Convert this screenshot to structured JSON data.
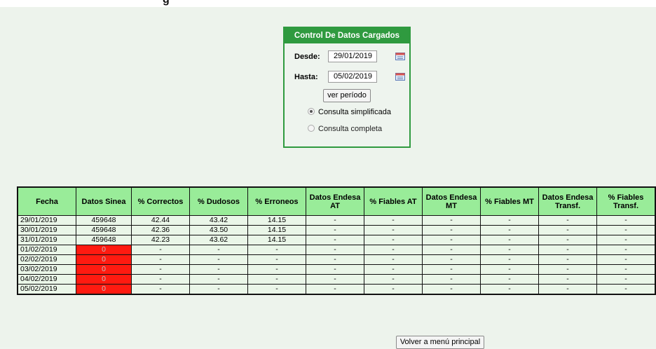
{
  "header": {
    "clipped_title": "g"
  },
  "panel": {
    "title": "Control De Datos Cargados",
    "desde_label": "Desde:",
    "desde_value": "29/01/2019",
    "hasta_label": "Hasta:",
    "hasta_value": "05/02/2019",
    "ver_button": "ver período",
    "radio_simplificada": "Consulta simplificada",
    "radio_completa": "Consulta completa",
    "selected_mode": "simplificada"
  },
  "table": {
    "headers": [
      "Fecha",
      "Datos Sinea",
      "% Correctos",
      "% Dudosos",
      "% Erroneos",
      "Datos Endesa AT",
      "% Fiables AT",
      "Datos Endesa MT",
      "% Fiables MT",
      "Datos Endesa Transf.",
      "% Fiables Transf."
    ],
    "rows": [
      [
        "29/01/2019",
        "459648",
        "42.44",
        "43.42",
        "14.15",
        "-",
        "-",
        "-",
        "-",
        "-",
        "-"
      ],
      [
        "30/01/2019",
        "459648",
        "42.36",
        "43.50",
        "14.15",
        "-",
        "-",
        "-",
        "-",
        "-",
        "-"
      ],
      [
        "31/01/2019",
        "459648",
        "42.23",
        "43.62",
        "14.15",
        "-",
        "-",
        "-",
        "-",
        "-",
        "-"
      ],
      [
        "01/02/2019",
        "0",
        "-",
        "-",
        "-",
        "-",
        "-",
        "-",
        "-",
        "-",
        "-"
      ],
      [
        "02/02/2019",
        "0",
        "-",
        "-",
        "-",
        "-",
        "-",
        "-",
        "-",
        "-",
        "-"
      ],
      [
        "03/02/2019",
        "0",
        "-",
        "-",
        "-",
        "-",
        "-",
        "-",
        "-",
        "-",
        "-"
      ],
      [
        "04/02/2019",
        "0",
        "-",
        "-",
        "-",
        "-",
        "-",
        "-",
        "-",
        "-",
        "-"
      ],
      [
        "05/02/2019",
        "0",
        "-",
        "-",
        "-",
        "-",
        "-",
        "-",
        "-",
        "-",
        "-"
      ]
    ]
  },
  "footer": {
    "volver_button": "Volver a menú principal"
  },
  "colors": {
    "panel_green": "#2f9a3f",
    "header_green": "#99ec99",
    "alert_red": "#ff1a10"
  }
}
